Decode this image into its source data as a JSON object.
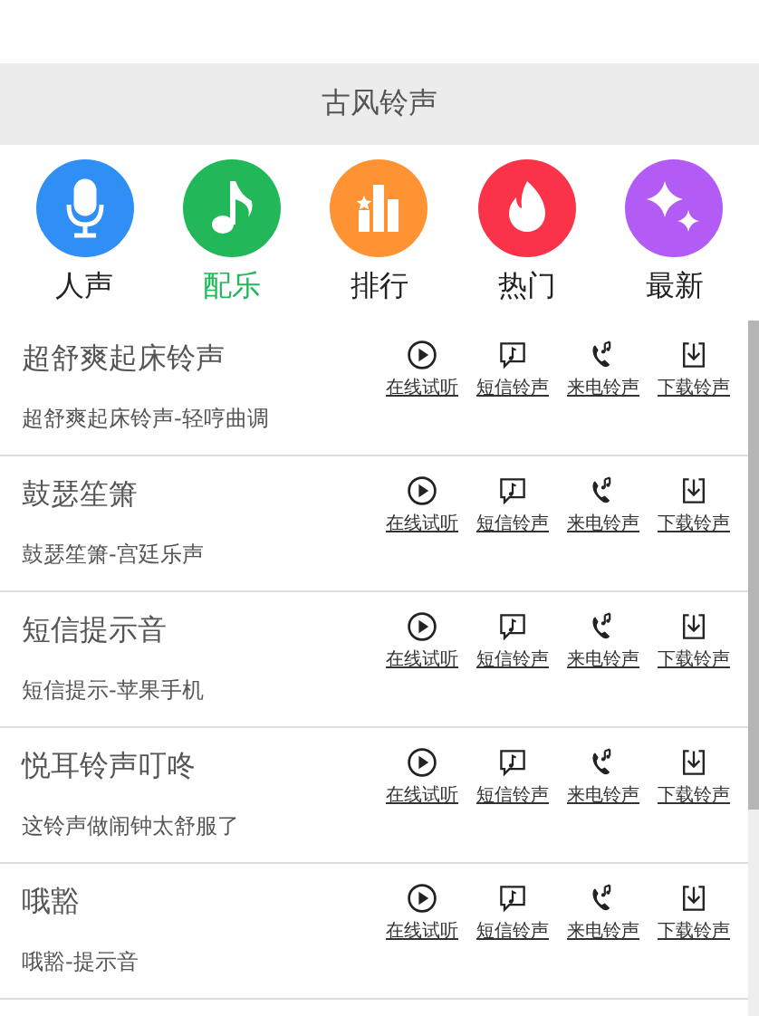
{
  "header": {
    "title": "古风铃声"
  },
  "categories": [
    {
      "label": "人声",
      "kind": "mic",
      "color": "#2f8ff5",
      "selected": false
    },
    {
      "label": "配乐",
      "kind": "note",
      "color": "#22b85a",
      "selected": true
    },
    {
      "label": "排行",
      "kind": "chart",
      "color": "#ff9233",
      "selected": false
    },
    {
      "label": "热门",
      "kind": "fire",
      "color": "#fa3348",
      "selected": false
    },
    {
      "label": "最新",
      "kind": "sparkle",
      "color": "#b25cf5",
      "selected": false
    }
  ],
  "ringtones": [
    {
      "title": "超舒爽起床铃声",
      "subtitle": "超舒爽起床铃声-轻哼曲调",
      "actions": [
        {
          "kind": "play",
          "label": "在线试听"
        },
        {
          "kind": "sms",
          "label": "短信铃声"
        },
        {
          "kind": "call",
          "label": "来电铃声"
        },
        {
          "kind": "download",
          "label": "下载铃声"
        }
      ]
    },
    {
      "title": "鼓瑟笙箫",
      "subtitle": "鼓瑟笙箫-宫廷乐声",
      "actions": [
        {
          "kind": "play",
          "label": "在线试听"
        },
        {
          "kind": "sms",
          "label": "短信铃声"
        },
        {
          "kind": "call",
          "label": "来电铃声"
        },
        {
          "kind": "download",
          "label": "下载铃声"
        }
      ]
    },
    {
      "title": "短信提示音",
      "subtitle": "短信提示-苹果手机",
      "actions": [
        {
          "kind": "play",
          "label": "在线试听"
        },
        {
          "kind": "sms",
          "label": "短信铃声"
        },
        {
          "kind": "call",
          "label": "来电铃声"
        },
        {
          "kind": "download",
          "label": "下载铃声"
        }
      ]
    },
    {
      "title": "悦耳铃声叮咚",
      "subtitle": "这铃声做闹钟太舒服了",
      "actions": [
        {
          "kind": "play",
          "label": "在线试听"
        },
        {
          "kind": "sms",
          "label": "短信铃声"
        },
        {
          "kind": "call",
          "label": "来电铃声"
        },
        {
          "kind": "download",
          "label": "下载铃声"
        }
      ]
    },
    {
      "title": "哦豁",
      "subtitle": "哦豁-提示音",
      "actions": [
        {
          "kind": "play",
          "label": "在线试听"
        },
        {
          "kind": "sms",
          "label": "短信铃声"
        },
        {
          "kind": "call",
          "label": "来电铃声"
        },
        {
          "kind": "download",
          "label": "下载铃声"
        }
      ]
    }
  ]
}
